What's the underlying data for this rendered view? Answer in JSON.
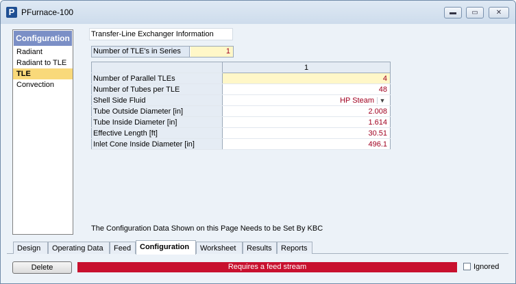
{
  "window": {
    "title": "PFurnace-100",
    "icon_letter": "P",
    "controls": {
      "minimize": "▬",
      "maximize": "▭",
      "close": "✕"
    }
  },
  "sidebar": {
    "header": "Configuration",
    "items": [
      {
        "label": "Radiant",
        "active": false
      },
      {
        "label": "Radiant to TLE",
        "active": false
      },
      {
        "label": "TLE",
        "active": true
      },
      {
        "label": "Convection",
        "active": false
      }
    ]
  },
  "section": {
    "title": "Transfer-Line Exchanger Information",
    "series_label": "Number of TLE's in Series",
    "series_value": "1"
  },
  "table": {
    "column_header": "1",
    "rows": [
      {
        "label": "Number of Parallel TLEs",
        "value": "4"
      },
      {
        "label": "Number of Tubes per TLE",
        "value": "48"
      },
      {
        "label": "Shell Side Fluid",
        "value": "HP Steam"
      },
      {
        "label": "Tube Outside Diameter [in]",
        "value": "2.008"
      },
      {
        "label": "Tube Inside Diameter [in]",
        "value": "1.614"
      },
      {
        "label": "Effective Length [ft]",
        "value": "30.51"
      },
      {
        "label": "Inlet Cone Inside Diameter [in]",
        "value": "496.1"
      }
    ]
  },
  "footer_note": "The Configuration Data Shown on this Page Needs to be Set By KBC",
  "tabs": [
    {
      "label": "Design",
      "active": false
    },
    {
      "label": "Operating Data",
      "active": false
    },
    {
      "label": "Feed",
      "active": false
    },
    {
      "label": "Configuration",
      "active": true
    },
    {
      "label": "Worksheet",
      "active": false
    },
    {
      "label": "Results",
      "active": false
    },
    {
      "label": "Reports",
      "active": false
    }
  ],
  "bottom": {
    "delete_label": "Delete",
    "status_text": "Requires a feed stream",
    "ignored_label": "Ignored"
  },
  "colors": {
    "status_bar": "#c8102e",
    "value_text": "#a00020",
    "active_item": "#f9d97a",
    "sidebar_header": "#7b8fc6"
  }
}
